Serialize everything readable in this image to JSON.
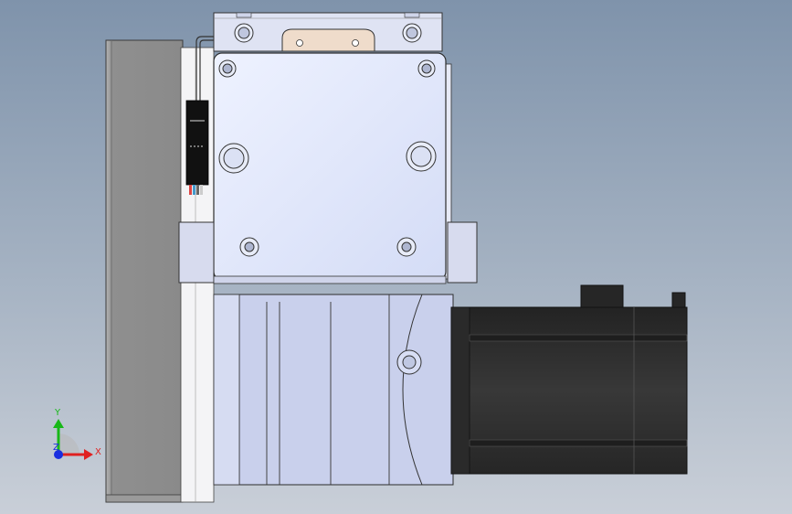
{
  "triad": {
    "x_label": "X",
    "y_label": "Y",
    "z_label": "Z",
    "x_color": "#e02020",
    "y_color": "#18b818",
    "z_color": "#1a2ee0"
  },
  "colors": {
    "plate_gray": "#8c8c8c",
    "bracket": "#e6e8f2",
    "gearbox": "#c8d0ec",
    "motor": "#2e2e2e",
    "label_tan": "#efdccb"
  }
}
